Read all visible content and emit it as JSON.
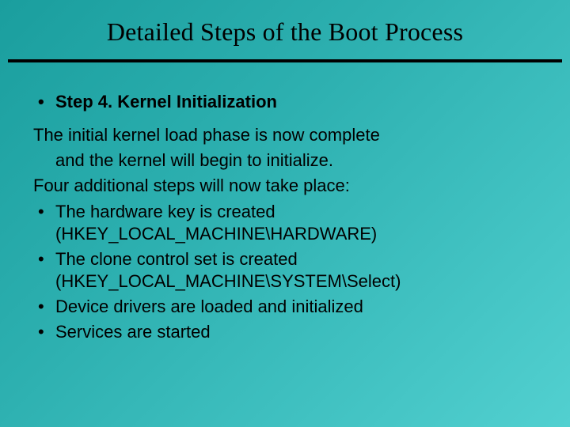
{
  "title": "Detailed Steps of the Boot Process",
  "stepHeading": "Step 4.   Kernel Initialization",
  "para1a": "The initial kernel load phase is now complete",
  "para1b": "and the kernel will begin to initialize.",
  "para2": "Four additional steps will now take place:",
  "bullets": [
    {
      "line1": "The hardware key is created",
      "line2": "(HKEY_LOCAL_MACHINE\\HARDWARE)"
    },
    {
      "line1": "The clone control set is created",
      "line2": "(HKEY_LOCAL_MACHINE\\SYSTEM\\Select)"
    },
    {
      "line1": "Device drivers are loaded and initialized",
      "line2": ""
    },
    {
      "line1": "Services are started",
      "line2": ""
    }
  ]
}
